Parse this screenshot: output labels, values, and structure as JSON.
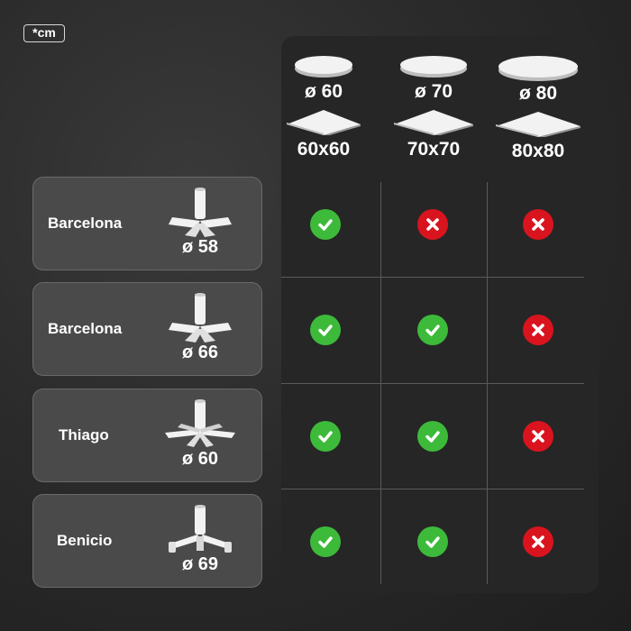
{
  "unit_badge": "*cm",
  "columns": [
    {
      "round_label": "ø 60",
      "square_label": "60x60"
    },
    {
      "round_label": "ø 70",
      "square_label": "70x70"
    },
    {
      "round_label": "ø 80",
      "square_label": "80x80"
    }
  ],
  "rows": [
    {
      "name": "Barcelona",
      "base_icon": "cross-base-icon",
      "diameter": "ø 58",
      "compat": [
        true,
        false,
        false
      ]
    },
    {
      "name": "Barcelona",
      "base_icon": "cross-base-icon",
      "diameter": "ø 66",
      "compat": [
        true,
        true,
        false
      ]
    },
    {
      "name": "Thiago",
      "base_icon": "star-base-icon",
      "diameter": "ø 60",
      "compat": [
        true,
        true,
        false
      ]
    },
    {
      "name": "Benicio",
      "base_icon": "tripod-base-icon",
      "diameter": "ø 69",
      "compat": [
        true,
        true,
        false
      ]
    }
  ],
  "colors": {
    "compatible": "#3dba3a",
    "incompatible": "#d9141e"
  }
}
